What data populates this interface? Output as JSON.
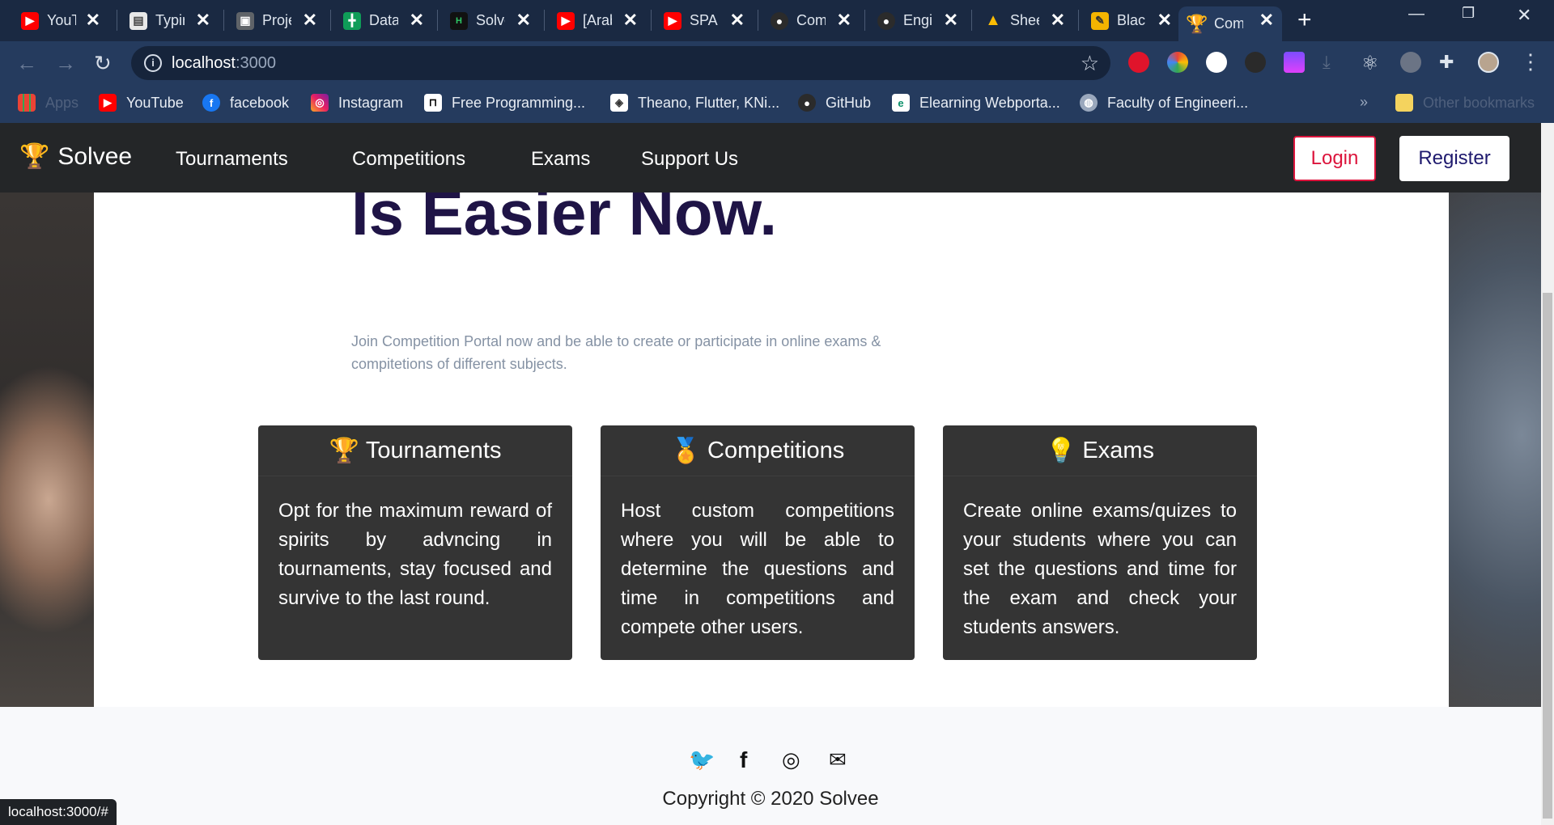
{
  "browser": {
    "tabs": [
      {
        "title": "YouTube",
        "icon": "youtube-icon",
        "color": "#ff0000"
      },
      {
        "title": "Typing",
        "icon": "typing-icon",
        "color": "#dddddd"
      },
      {
        "title": "Project",
        "icon": "project-icon",
        "color": "#5f6368"
      },
      {
        "title": "Data",
        "icon": "sheets-icon",
        "color": "#0f9d58"
      },
      {
        "title": "Solve",
        "icon": "hackerrank-icon",
        "color": "#111111"
      },
      {
        "title": "[Arabic]",
        "icon": "youtube-icon",
        "color": "#ff0000"
      },
      {
        "title": "SPA",
        "icon": "youtube-icon",
        "color": "#ff0000"
      },
      {
        "title": "Com",
        "icon": "github-icon",
        "color": "#333333"
      },
      {
        "title": "Engi",
        "icon": "github-icon",
        "color": "#333333"
      },
      {
        "title": "Shee",
        "icon": "drive-icon",
        "color": "#fbbc04"
      },
      {
        "title": "Black",
        "icon": "notepad-icon",
        "color": "#f4b400"
      },
      {
        "title": "Com",
        "icon": "trophy-icon",
        "color": "#f4b400"
      }
    ],
    "address": {
      "host": "localhost",
      "port": ":3000"
    },
    "bookmarks": [
      {
        "label": "Apps",
        "icon": "apps-grid-icon"
      },
      {
        "label": "YouTube",
        "icon": "youtube-icon"
      },
      {
        "label": "facebook",
        "icon": "facebook-icon"
      },
      {
        "label": "Instagram",
        "icon": "instagram-icon"
      },
      {
        "label": "Free Programming...",
        "icon": "bookmark-site-icon"
      },
      {
        "label": "Theano, Flutter, KNi...",
        "icon": "bookmark-site-icon"
      },
      {
        "label": "GitHub",
        "icon": "github-icon"
      },
      {
        "label": "Elearning Webporta...",
        "icon": "elearning-icon"
      },
      {
        "label": "Faculty of Engineeri...",
        "icon": "globe-icon"
      },
      {
        "label": "Other bookmarks",
        "icon": "folder-icon"
      }
    ],
    "more": "»",
    "status_url": "localhost:3000/#"
  },
  "site": {
    "brand": "Solvee",
    "nav": [
      "Tournaments",
      "Competitions",
      "Exams",
      "Support Us"
    ],
    "login": "Login",
    "register": "Register",
    "hero_title": "Is Easier Now.",
    "hero_subtitle": "Join Competition Portal now and be able to create or participate in online exams & compitetions of different subjects.",
    "features": [
      {
        "title": "Tournaments",
        "icon": "trophy-icon",
        "text": "Opt for the maximum reward of spirits by advncing in tournaments, stay focused and survive to the last round."
      },
      {
        "title": "Competitions",
        "icon": "medal-icon",
        "text": "Host custom competitions where you will be able to determine the questions and time in competitions and compete other users."
      },
      {
        "title": "Exams",
        "icon": "lightbulb-icon",
        "text": "Create online exams/quizes to your students where you can set the questions and time for the exam and check your students answers."
      }
    ],
    "footer": {
      "social": [
        "twitter-icon",
        "facebook-icon",
        "instagram-icon",
        "mail-icon"
      ],
      "copyright": "Copyright © 2020 Solvee"
    }
  },
  "colors": {
    "accent": "#dc143c",
    "brand_dark": "#1f1446",
    "card_bg": "#343434",
    "twitter": "#1da1f2"
  }
}
